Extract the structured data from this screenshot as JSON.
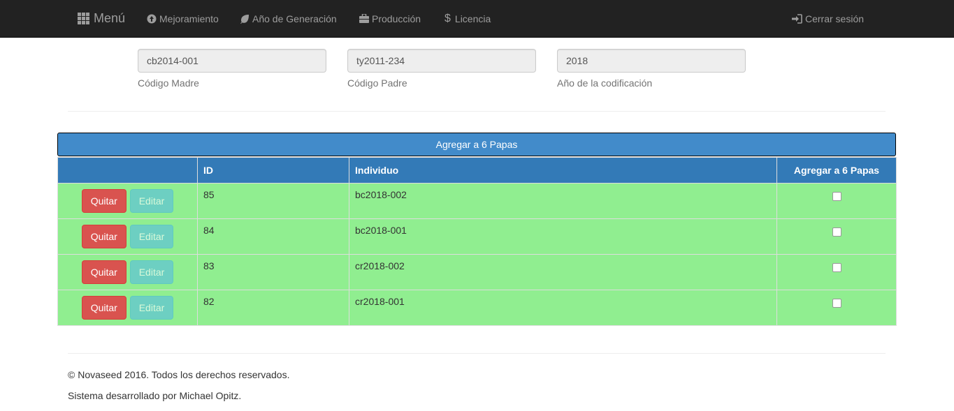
{
  "navbar": {
    "brand": "Menú",
    "items": [
      {
        "label": "Mejoramiento",
        "icon": "arrow-up-circle-icon"
      },
      {
        "label": "Año de Generación",
        "icon": "leaf-icon"
      },
      {
        "label": "Producción",
        "icon": "briefcase-icon"
      },
      {
        "label": "Licencia",
        "icon": "dollar-icon"
      }
    ],
    "logout": {
      "label": "Cerrar sesión",
      "icon": "log-in-icon"
    }
  },
  "form": {
    "madre": {
      "value": "cb2014-001",
      "label": "Código Madre"
    },
    "padre": {
      "value": "ty2011-234",
      "label": "Código Padre"
    },
    "ano": {
      "value": "2018",
      "label": "Año de la codificación"
    }
  },
  "add_button": "Agregar a 6 Papas",
  "table": {
    "headers": [
      "",
      "ID",
      "Individuo",
      "Agregar a 6 Papas"
    ],
    "remove_label": "Quitar",
    "edit_label": "Editar",
    "rows": [
      {
        "id": "85",
        "individuo": "bc2018-002",
        "checked": false
      },
      {
        "id": "84",
        "individuo": "bc2018-001",
        "checked": false
      },
      {
        "id": "83",
        "individuo": "cr2018-002",
        "checked": false
      },
      {
        "id": "82",
        "individuo": "cr2018-001",
        "checked": false
      }
    ]
  },
  "footer": {
    "copyright": "© Novaseed 2016. Todos los derechos reservados.",
    "developer": "Sistema desarrollado por Michael Opitz."
  },
  "colors": {
    "navbar": "#222222",
    "row_bg": "#90ee90",
    "header_bg": "#337ab7",
    "add_bar": "#428bca",
    "danger": "#d9534f",
    "info": "#5bc0de"
  }
}
